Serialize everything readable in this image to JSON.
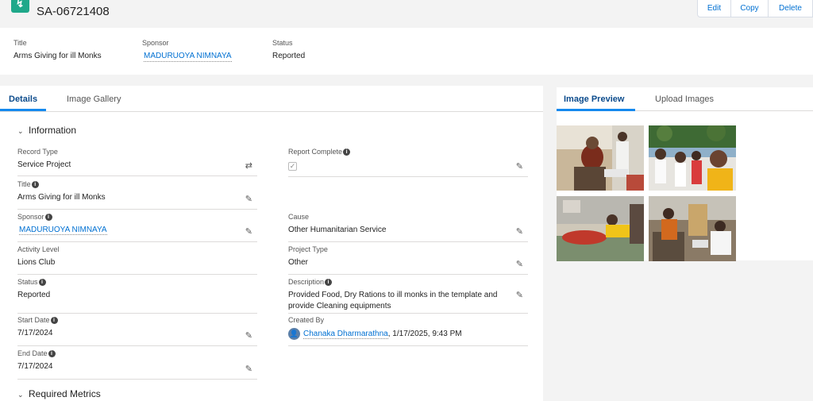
{
  "header": {
    "record_number": "SA-06721408",
    "actions": {
      "edit": "Edit",
      "copy": "Copy",
      "delete": "Delete"
    }
  },
  "highlights": [
    {
      "label": "Title",
      "value": "Arms Giving for ill Monks"
    },
    {
      "label": "Sponsor",
      "value": "MADURUOYA NIMNAYA"
    },
    {
      "label": "Status",
      "value": "Reported"
    }
  ],
  "tabs": {
    "details": "Details",
    "gallery": "Image Gallery"
  },
  "sections": {
    "information": "Information",
    "metrics": "Required Metrics"
  },
  "fields": {
    "record_type": {
      "label": "Record Type",
      "value": "Service Project"
    },
    "title": {
      "label": "Title",
      "value": "Arms Giving for ill Monks"
    },
    "sponsor": {
      "label": "Sponsor",
      "value": "MADURUOYA NIMNAYA"
    },
    "activity_level": {
      "label": "Activity Level",
      "value": "Lions Club"
    },
    "status": {
      "label": "Status",
      "value": "Reported"
    },
    "start_date": {
      "label": "Start Date",
      "value": "7/17/2024"
    },
    "end_date": {
      "label": "End Date",
      "value": "7/17/2024"
    },
    "report_complete": {
      "label": "Report Complete",
      "checked": true
    },
    "cause": {
      "label": "Cause",
      "value": "Other Humanitarian Service"
    },
    "project_type": {
      "label": "Project Type",
      "value": "Other"
    },
    "description": {
      "label": "Description",
      "value": "Provided Food, Dry Rations to ill monks in the template and provide Cleaning equipments"
    },
    "created_by": {
      "label": "Created By",
      "user": "Chanaka Dharmarathna",
      "timestamp": ", 1/17/2025, 9:43 PM"
    }
  },
  "image_panel": {
    "preview_tab": "Image Preview",
    "upload_tab": "Upload Images"
  },
  "colors": {
    "accent": "#0070d2",
    "tab_active": "#0b4b8c",
    "icon_bg": "#1fa88a"
  }
}
